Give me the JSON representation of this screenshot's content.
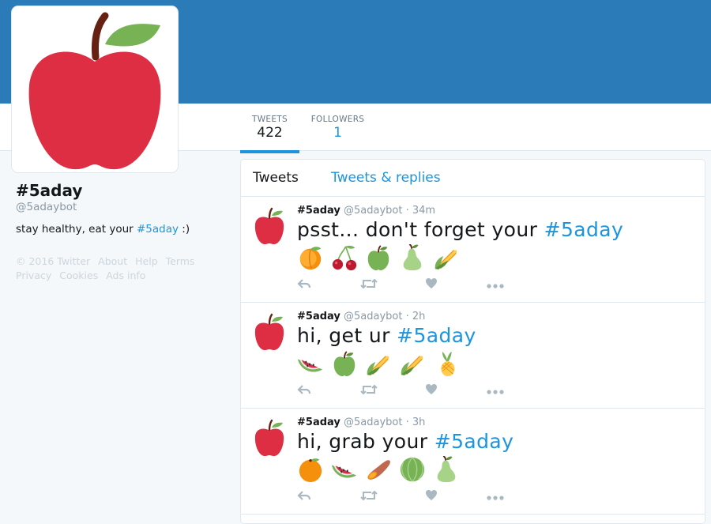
{
  "profile": {
    "name": "#5aday",
    "handle": "@5adaybot",
    "bio_text": "stay healthy, eat your ",
    "bio_tag": "#5aday",
    "bio_suffix": " :)"
  },
  "nav": {
    "tweets_label": "TWEETS",
    "tweets_count": "422",
    "followers_label": "FOLLOWERS",
    "followers_count": "1"
  },
  "footer": {
    "links": [
      "© 2016 Twitter",
      "About",
      "Help",
      "Terms",
      "Privacy",
      "Cookies",
      "Ads info"
    ]
  },
  "timeline": {
    "tabs": [
      "Tweets",
      "Tweets & replies"
    ],
    "tweets": [
      {
        "name": "#5aday",
        "handle": "@5adaybot",
        "time": "· 34m",
        "text": "psst... don't forget your ",
        "tag": "#5aday",
        "emoji": [
          "peach-icon",
          "cherries-icon",
          "green-apple-icon",
          "pear-icon",
          "corn-icon"
        ]
      },
      {
        "name": "#5aday",
        "handle": "@5adaybot",
        "time": "· 2h",
        "text": "hi, get ur ",
        "tag": "#5aday",
        "emoji": [
          "watermelon-icon",
          "green-apple-icon",
          "corn-icon",
          "corn-icon",
          "pineapple-icon"
        ]
      },
      {
        "name": "#5aday",
        "handle": "@5adaybot",
        "time": "· 3h",
        "text": "hi, grab your ",
        "tag": "#5aday",
        "emoji": [
          "orange-icon",
          "watermelon-icon",
          "sweet-potato-icon",
          "melon-icon",
          "pear-icon"
        ]
      }
    ]
  },
  "colors": {
    "banner": "#2b7bb9",
    "link": "#1b95e0",
    "apple_red": "#dd2e44"
  }
}
